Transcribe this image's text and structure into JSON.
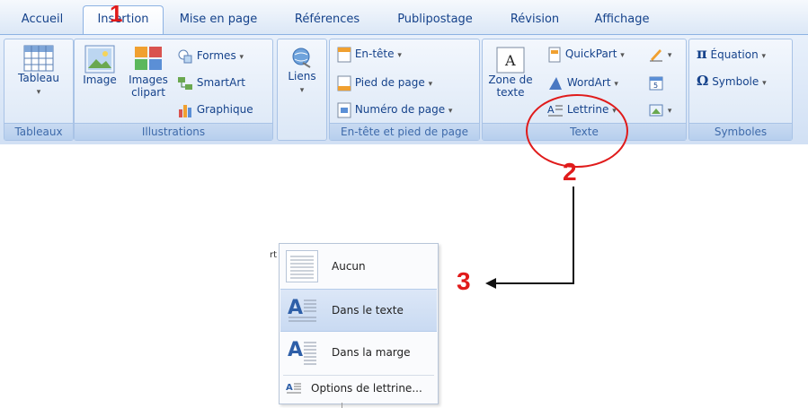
{
  "tabs": [
    "Accueil",
    "Insertion",
    "Mise en page",
    "Références",
    "Publipostage",
    "Révision",
    "Affichage"
  ],
  "active_tab": "Insertion",
  "groups": {
    "tableaux": {
      "caption": "Tableaux",
      "tableau_label": "Tableau"
    },
    "illustrations": {
      "caption": "Illustrations",
      "image_label": "Image",
      "images_clipart_line1": "Images",
      "images_clipart_line2": "clipart",
      "formes_label": "Formes",
      "smartart_label": "SmartArt",
      "graphique_label": "Graphique"
    },
    "liens": {
      "label": "Liens"
    },
    "entete": {
      "caption": "En-tête et pied de page",
      "entete_label": "En-tête",
      "pied_label": "Pied de page",
      "numero_label": "Numéro de page"
    },
    "texte": {
      "caption": "Texte",
      "zone_line1": "Zone de",
      "zone_line2": "texte",
      "quickpart_label": "QuickPart",
      "wordart_label": "WordArt",
      "lettrine_label": "Lettrine"
    },
    "symboles": {
      "caption": "Symboles",
      "equation_label": "Équation",
      "symbole_label": "Symbole"
    }
  },
  "annotations": {
    "step1": "1",
    "step2": "2",
    "step3": "3"
  },
  "dropdown": {
    "items": [
      "Aucun",
      "Dans le texte",
      "Dans la marge"
    ],
    "highlighted": "Dans le texte",
    "options_label": "Options de lettrine...",
    "doc_fragment": "rt"
  },
  "colors": {
    "ribbon_text": "#15428b",
    "annotation": "#e01b1b",
    "hover": "#c9daf2"
  }
}
